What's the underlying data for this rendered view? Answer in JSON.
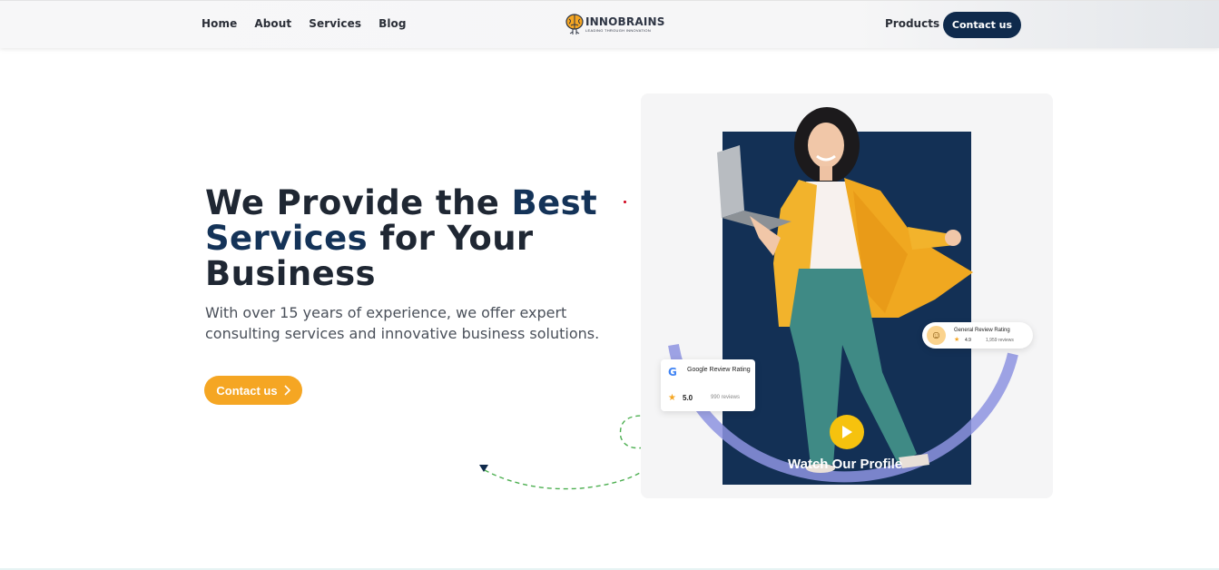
{
  "nav": {
    "links": [
      "Home",
      "About",
      "Services",
      "Blog"
    ],
    "logo_name": "INNOBRAINS",
    "logo_tagline": "LEADING THROUGH INNOVATION",
    "products_label": "Products",
    "contact_label": "Contact us"
  },
  "hero": {
    "title_part1": "We Provide the ",
    "title_accent1": "Best Services",
    "title_part2": " for Your Business",
    "description": "With over 15 years of experience, we offer expert consulting services and innovative business solutions.",
    "cta_label": "Contact us",
    "cta_icon": "chevron-right-icon"
  },
  "media": {
    "watch_label": "Watch Our Profile",
    "play_icon": "play-icon"
  },
  "google_review": {
    "icon": "google-g-icon",
    "title": "Google Review Rating",
    "score": "5.0",
    "count": "990 reviews"
  },
  "general_review": {
    "icon": "smile-icon",
    "title": "General Review Rating",
    "score": "4.9",
    "count": "1,959 reviews"
  },
  "colors": {
    "navy": "#0f2a4c",
    "accent_orange": "#f5a623",
    "play_yellow": "#f6c20e",
    "arc_lavender": "#8d93e0"
  }
}
